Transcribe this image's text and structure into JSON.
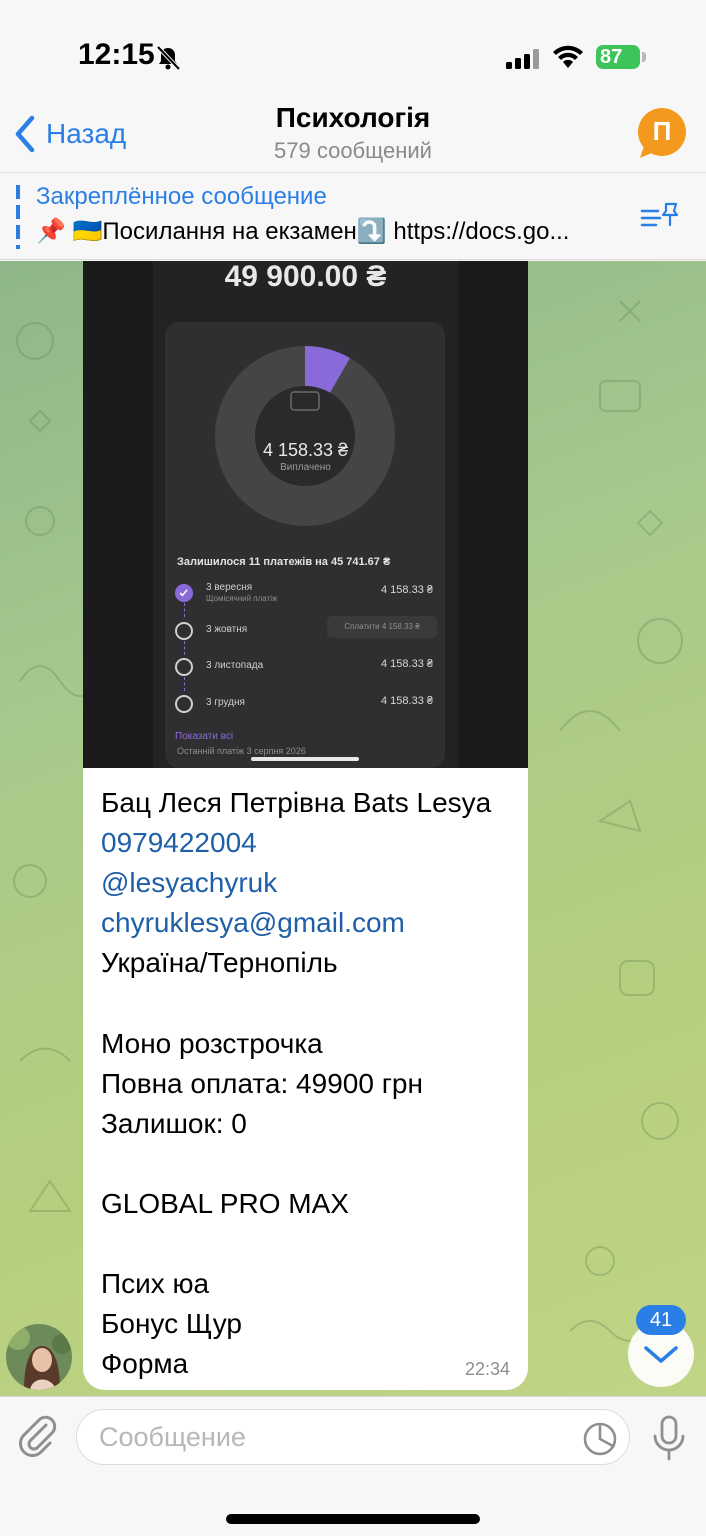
{
  "status_bar": {
    "time": "12:15",
    "battery": "87"
  },
  "header": {
    "back_label": "Назад",
    "title": "Психологія",
    "subtitle": "579 сообщений",
    "avatar_letter": "П",
    "avatar_color": "#f39a1e"
  },
  "pinned": {
    "title": "Закреплённое сообщение",
    "text": "📌 🇺🇦Посилання на екзамен⤵️ https://docs.go..."
  },
  "message": {
    "screenshot": {
      "amount": "49 900.00 ₴",
      "paid_value": "4 158.33 ₴",
      "paid_label": "Виплачено",
      "paid_fraction": 0.0833,
      "remaining": "Залишилося 11 платежів на 45 741.67 ₴",
      "payments": [
        {
          "date": "3 вересня",
          "note": "Щомісячний платіж",
          "amount": "4 158.33 ₴",
          "status": "paid"
        },
        {
          "date": "3 жовтня",
          "button": "Сплатити  4 158.33 ₴",
          "status": "due"
        },
        {
          "date": "3 листопада",
          "amount": "4 158.33 ₴",
          "status": "upcoming"
        },
        {
          "date": "3 грудня",
          "amount": "4 158.33 ₴",
          "status": "upcoming"
        }
      ],
      "show_all": "Показати всі",
      "last_payment": "Останній платіж 3 серпня 2026"
    },
    "lines": [
      "Бац Леся Петрівна Bats Lesya",
      "0979422004",
      "@lesyachyruk",
      "chyruklesya@gmail.com",
      "Україна/Тернопіль",
      "",
      "Моно розстрочка",
      "Повна оплата: 49900 грн",
      "Залишок: 0",
      "",
      "GLOBAL PRO MAX",
      "",
      "Псих юа",
      "Бонус Щур",
      "Форма"
    ],
    "time": "22:34"
  },
  "unread_count": "41",
  "input": {
    "placeholder": "Сообщение"
  },
  "colors": {
    "accent": "#2a7fe6",
    "link": "#1f5fa8",
    "purple": "#8a6ad8",
    "battery": "#3dc45a"
  }
}
